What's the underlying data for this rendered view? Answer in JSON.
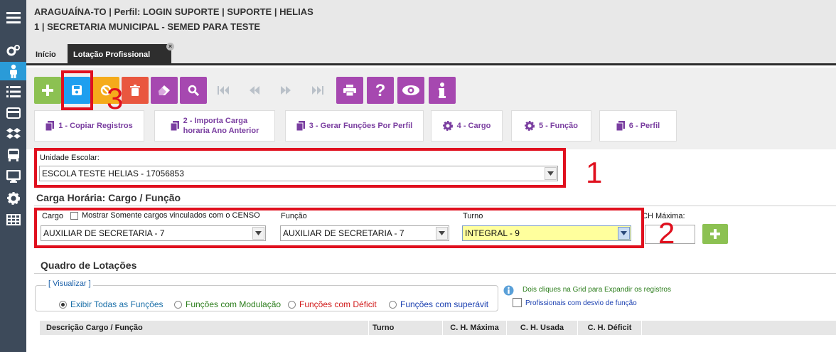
{
  "header": {
    "line1": "ARAGUAÍNA-TO | Perfil: LOGIN SUPORTE | SUPORTE | HELIAS",
    "line2": "1 | SECRETARIA MUNICIPAL - SEMED PARA TESTE"
  },
  "tabs": [
    {
      "label": "Início"
    },
    {
      "label": "Lotação Profissional",
      "close": "×"
    }
  ],
  "sidebar_icons": [
    "menu-icon",
    "gears-icon",
    "user-icon",
    "list-icon",
    "card-icon",
    "dropbox-icon",
    "bus-icon",
    "monitor-icon",
    "gear-icon",
    "table-icon"
  ],
  "toolbar": {
    "buttons": [
      {
        "name": "add",
        "color": "#8cc152"
      },
      {
        "name": "save",
        "color": "#1e9fef"
      },
      {
        "name": "cancel",
        "color": "#f5ab1b"
      },
      {
        "name": "delete",
        "color": "#e9573f"
      },
      {
        "name": "eraser",
        "color": "#a648b0"
      },
      {
        "name": "search",
        "color": "#a648b0"
      },
      {
        "name": "first",
        "color": "#9aa0a8"
      },
      {
        "name": "prev",
        "color": "#9aa0a8"
      },
      {
        "name": "next",
        "color": "#9aa0a8"
      },
      {
        "name": "last",
        "color": "#9aa0a8"
      },
      {
        "name": "print",
        "color": "#a648b0"
      },
      {
        "name": "help",
        "color": "#a648b0"
      },
      {
        "name": "view",
        "color": "#a648b0"
      },
      {
        "name": "info",
        "color": "#a648b0"
      }
    ],
    "sub": {
      "copy": "1 - Copiar Registros",
      "import_1": "2 - Importa Carga",
      "import_2": "horaria Ano Anterior",
      "gen": "3 - Gerar Funções Por Perfil",
      "cargo": "4 - Cargo",
      "funcao": "5 - Função",
      "perfil": "6 - Perfil"
    }
  },
  "unidade": {
    "label": "Unidade Escolar:",
    "value": "ESCOLA TESTE HELIAS - 17056853"
  },
  "carga": {
    "title": "Carga Horária: Cargo / Função",
    "cargo_label": "Cargo",
    "cargo_check": "Mostrar Somente cargos vinculados com o CENSO",
    "cargo_value": "AUXILIAR DE SECRETARIA - 7",
    "funcao_label": "Função",
    "funcao_value": "AUXILIAR DE SECRETARIA - 7",
    "turno_label": "Turno",
    "turno_value": "INTEGRAL - 9",
    "chmax_label": "CH Máxima:",
    "chmax_value": ""
  },
  "quadro": {
    "title": "Quadro de Lotações",
    "visualizar": "[ Visualizar ]",
    "radios": [
      {
        "label": "Exibir Todas as Funções",
        "color": "#1a6fa8",
        "checked": true
      },
      {
        "label": "Funções com Modulação",
        "color": "#2b7d1b",
        "checked": false
      },
      {
        "label": "Funções com Déficit",
        "color": "#d11a1a",
        "checked": false
      },
      {
        "label": "Funções com superávit",
        "color": "#1a3fb0",
        "checked": false
      }
    ],
    "hint": "Dois cliques na Grid para Expandir os registros",
    "desvio": "Profissionais com desvio de função",
    "columns": [
      "Descrição Cargo / Função",
      "Turno",
      "C. H. Máxima",
      "C. H. Usada",
      "C. H. Déficit"
    ]
  },
  "annotations": [
    "1",
    "2",
    "3"
  ],
  "colors": {
    "accent_red": "#e0101e",
    "purple": "#7a3ea0",
    "sidebar": "#3d4a5a",
    "turno_bg": "#ffff9d"
  }
}
